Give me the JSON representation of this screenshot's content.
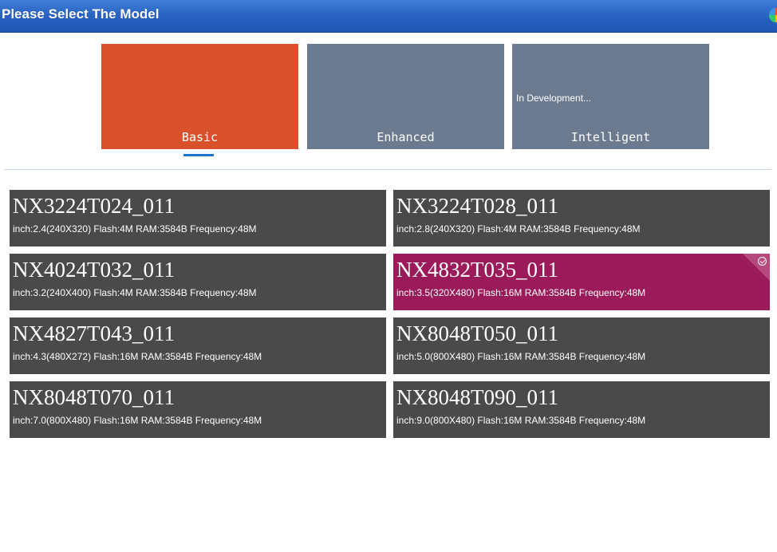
{
  "window": {
    "title": "Please Select The Model"
  },
  "tabs": [
    {
      "label": "Basic",
      "note": ""
    },
    {
      "label": "Enhanced",
      "note": ""
    },
    {
      "label": "Intelligent",
      "note": "In Development..."
    }
  ],
  "selected_tab": "Basic",
  "selected_model": "NX4832T035_011",
  "models": [
    {
      "name": "NX3224T024_011",
      "spec": "inch:2.4(240X320) Flash:4M RAM:3584B Frequency:48M"
    },
    {
      "name": "NX3224T028_011",
      "spec": "inch:2.8(240X320) Flash:4M RAM:3584B Frequency:48M"
    },
    {
      "name": "NX4024T032_011",
      "spec": "inch:3.2(240X400) Flash:4M RAM:3584B Frequency:48M"
    },
    {
      "name": "NX4832T035_011",
      "spec": "inch:3.5(320X480) Flash:16M RAM:3584B Frequency:48M"
    },
    {
      "name": "NX4827T043_011",
      "spec": "inch:4.3(480X272) Flash:16M RAM:3584B Frequency:48M"
    },
    {
      "name": "NX8048T050_011",
      "spec": "inch:5.0(800X480) Flash:16M RAM:3584B Frequency:48M"
    },
    {
      "name": "NX8048T070_011",
      "spec": "inch:7.0(800X480) Flash:16M RAM:3584B Frequency:48M"
    },
    {
      "name": "NX8048T090_011",
      "spec": "inch:9.0(800X480) Flash:16M RAM:3584B Frequency:48M"
    }
  ],
  "colors": {
    "basic_tab": "#d9512b",
    "other_tab": "#6c7a90",
    "card": "#4a4a4a",
    "selected_card": "#9b1b5a",
    "indicator": "#1e73c8"
  },
  "icons": {
    "app": "app-logo-icon",
    "selected": "check-circle-icon"
  }
}
